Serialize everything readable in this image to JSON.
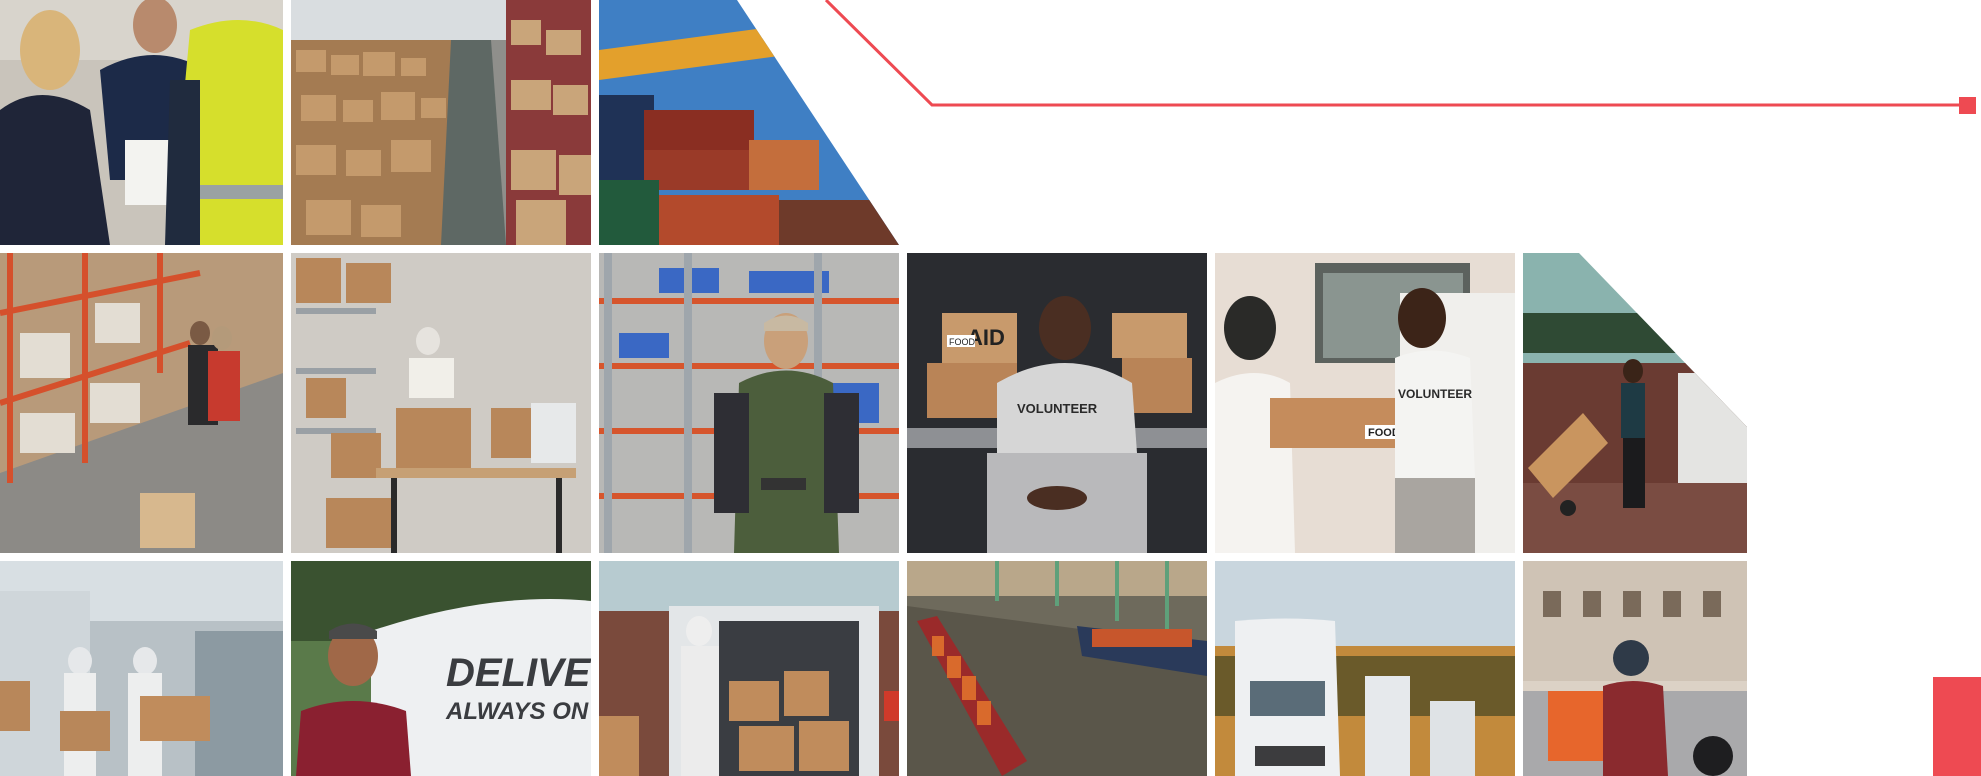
{
  "colors": {
    "accent": "#ee4a52",
    "background": "#ffffff"
  },
  "collage": {
    "row1": [
      {
        "subject": "office-staff-with-clipboard"
      },
      {
        "subject": "warehouse-aisle-with-boxes"
      },
      {
        "subject": "shipping-containers-and-crane"
      }
    ],
    "row2": [
      {
        "subject": "worker-at-warehouse-shelves"
      },
      {
        "subject": "packing-boxes-at-desk"
      },
      {
        "subject": "warehouse-worker-with-tablet"
      },
      {
        "subject": "volunteer-sitting-in-van",
        "texts": {
          "box_aid": "AID",
          "box_food": "FOOD",
          "shirt": "VOLUNTEER"
        }
      },
      {
        "subject": "volunteers-handing-food-box",
        "texts": {
          "shirt": "VOLUNTEER",
          "box_food": "FOOD"
        }
      },
      {
        "subject": "courier-with-hand-truck"
      }
    ],
    "row3": [
      {
        "subject": "workers-loading-van-in-protective-suits"
      },
      {
        "subject": "delivery-driver-thumbs-up",
        "texts": {
          "van_line1": "DELIVER",
          "van_line2": "ALWAYS ON TI"
        }
      },
      {
        "subject": "worker-in-suit-loading-van"
      },
      {
        "subject": "container-ships-at-port"
      },
      {
        "subject": "white-trucks-parked"
      },
      {
        "subject": "scooter-food-courier"
      }
    ]
  }
}
